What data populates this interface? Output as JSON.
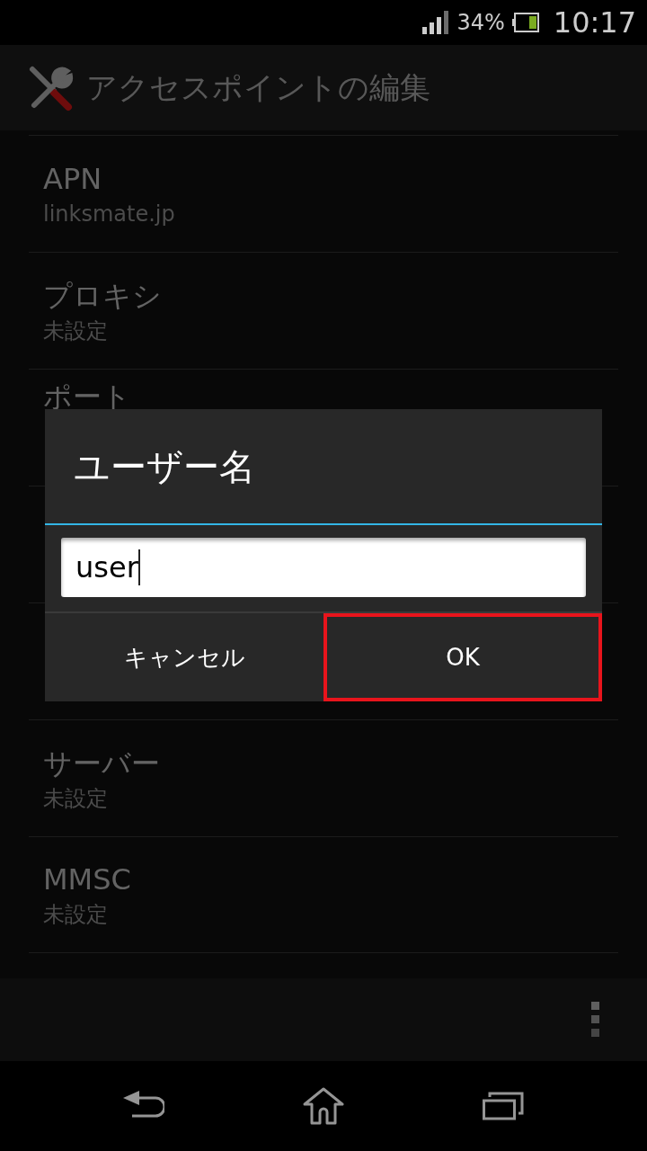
{
  "status_bar": {
    "battery": "34%",
    "time": "10:17"
  },
  "action_bar": {
    "title": "アクセスポイントの編集"
  },
  "settings": [
    {
      "title": "APN",
      "value": "linksmate.jp"
    },
    {
      "title": "プロキシ",
      "value": "未設定"
    },
    {
      "title": "ポート"
    }
  ],
  "settings_below": [
    {
      "title": "サーバー",
      "value": "未設定"
    },
    {
      "title": "MMSC",
      "value": "未設定"
    }
  ],
  "dialog": {
    "title": "ユーザー名",
    "input": {
      "value": "user"
    },
    "buttons": [
      {
        "label": "キャンセル",
        "highlighted": false
      },
      {
        "label": "OK",
        "highlighted": true
      }
    ]
  }
}
